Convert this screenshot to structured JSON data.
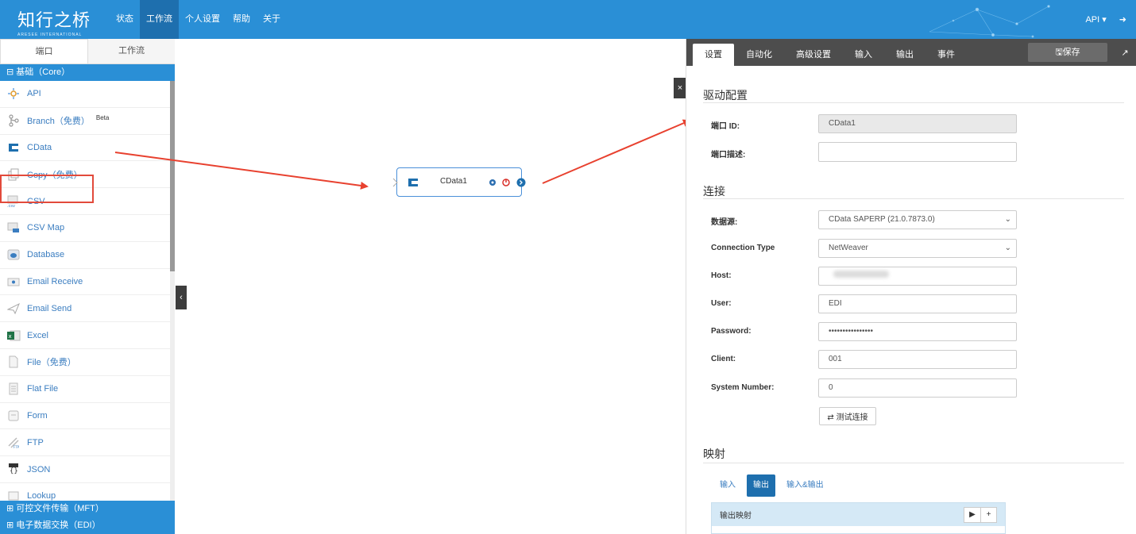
{
  "header": {
    "logo_text": "知行之桥",
    "logo_sub": "ARESEE INTERNATIONAL",
    "nav": [
      "状态",
      "工作流",
      "个人设置",
      "帮助",
      "关于"
    ],
    "active_nav": "工作流",
    "user_menu": "API ▾",
    "logout_icon": "logout-icon"
  },
  "left": {
    "tabs": [
      "端口",
      "工作流"
    ],
    "section_core": "⊟ 基础（Core）",
    "items": [
      {
        "label": "API",
        "icon": "api-icon"
      },
      {
        "label": "Branch（免费）",
        "icon": "branch-icon",
        "badge": "Beta"
      },
      {
        "label": "CData",
        "icon": "cdata-icon"
      },
      {
        "label": "Copy（免费）",
        "icon": "copy-icon"
      },
      {
        "label": "CSV",
        "icon": "csv-icon"
      },
      {
        "label": "CSV Map",
        "icon": "csv-map-icon"
      },
      {
        "label": "Database",
        "icon": "database-icon"
      },
      {
        "label": "Email Receive",
        "icon": "email-receive-icon"
      },
      {
        "label": "Email Send",
        "icon": "email-send-icon"
      },
      {
        "label": "Excel",
        "icon": "excel-icon"
      },
      {
        "label": "File（免费）",
        "icon": "file-icon"
      },
      {
        "label": "Flat File",
        "icon": "flat-file-icon"
      },
      {
        "label": "Form",
        "icon": "form-icon"
      },
      {
        "label": "FTP",
        "icon": "ftp-icon"
      },
      {
        "label": "JSON",
        "icon": "json-icon"
      },
      {
        "label": "Lookup",
        "icon": "lookup-icon"
      }
    ],
    "section_mft": "⊞ 可控文件传输（MFT）",
    "section_edi": "⊞ 电子数据交换（EDI）"
  },
  "canvas": {
    "node_name": "CData1"
  },
  "right": {
    "tabs": [
      "设置",
      "自动化",
      "高级设置",
      "输入",
      "输出",
      "事件"
    ],
    "active_tab": "设置",
    "save_label": "🖫保存",
    "driver_title": "驱动配置",
    "port_id_label": "端口 ID:",
    "port_id_value": "CData1",
    "port_desc_label": "端口描述:",
    "port_desc_value": "",
    "conn_title": "连接",
    "datasource_label": "数据源:",
    "datasource_value": "CData SAPERP (21.0.7873.0)",
    "conntype_label": "Connection Type",
    "conntype_value": "NetWeaver",
    "host_label": "Host:",
    "user_label": "User:",
    "user_value": "EDI",
    "password_label": "Password:",
    "password_value": "••••••••••••••••",
    "client_label": "Client:",
    "client_value": "001",
    "sysnum_label": "System Number:",
    "sysnum_value": "0",
    "test_label": "⇄ 测试连接",
    "mapping_title": "映射",
    "mapping_tabs": [
      "输入",
      "输出",
      "输入&输出"
    ],
    "active_mapping_tab": "输出",
    "output_mapping": "输出映射"
  }
}
